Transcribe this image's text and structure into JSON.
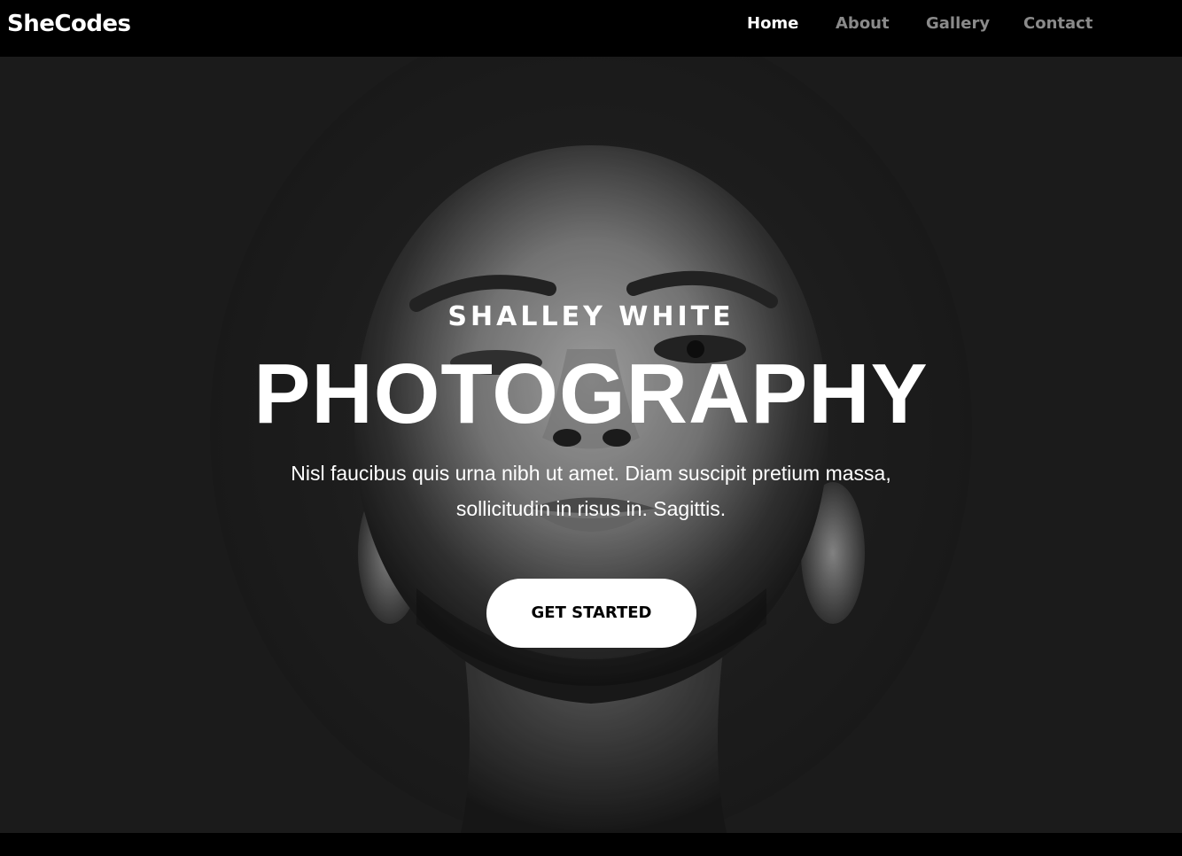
{
  "navbar": {
    "brand": "SheCodes",
    "links": [
      {
        "label": "Home",
        "active": true
      },
      {
        "label": "About",
        "active": false
      },
      {
        "label": "Gallery",
        "active": false
      },
      {
        "label": "Contact",
        "active": false
      }
    ]
  },
  "hero": {
    "subtitle": "SHALLEY WHITE",
    "title": "PHOTOGRAPHY",
    "text": "Nisl faucibus quis urna nibh ut amet. Diam suscipit pretium massa, sollicitudin in risus in. Sagittis.",
    "cta_label": "GET STARTED",
    "background_image": "black-and-white portrait of a woman's face"
  },
  "colors": {
    "navbar_bg": "#000000",
    "hero_bg": "#212121",
    "nav_active": "#ffffff",
    "nav_inactive": "#8a8a8a",
    "button_bg": "#ffffff",
    "button_text": "#000000"
  }
}
